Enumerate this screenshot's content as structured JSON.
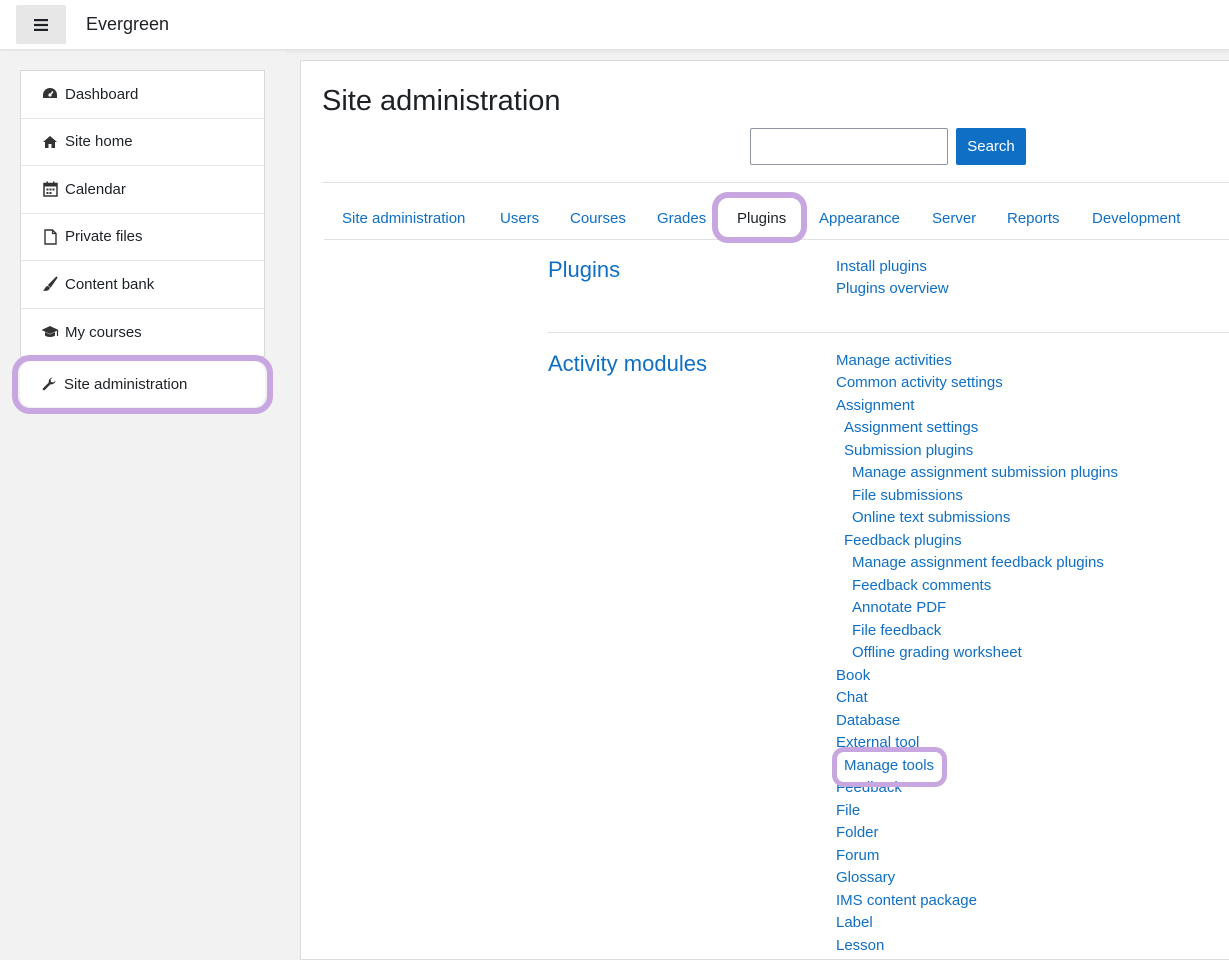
{
  "navbar": {
    "brand": "Evergreen",
    "menu_icon": "hamburger-menu-icon"
  },
  "drawer": {
    "items": [
      {
        "label": "Dashboard",
        "icon": "dashboard-icon"
      },
      {
        "label": "Site home",
        "icon": "home-icon"
      },
      {
        "label": "Calendar",
        "icon": "calendar-icon"
      },
      {
        "label": "Private files",
        "icon": "file-icon"
      },
      {
        "label": "Content bank",
        "icon": "paint-brush-icon"
      },
      {
        "label": "My courses",
        "icon": "graduation-cap-icon"
      }
    ],
    "site_admin": {
      "label": "Site administration",
      "icon": "wrench-icon"
    }
  },
  "main": {
    "title": "Site administration",
    "search": {
      "value": "",
      "placeholder": "",
      "button_label": "Search"
    },
    "tabs": [
      {
        "label": "Site administration"
      },
      {
        "label": "Users"
      },
      {
        "label": "Courses"
      },
      {
        "label": "Grades"
      },
      {
        "label": "Plugins",
        "active": true
      },
      {
        "label": "Appearance"
      },
      {
        "label": "Server"
      },
      {
        "label": "Reports"
      },
      {
        "label": "Development"
      }
    ],
    "sections": [
      {
        "heading": "Plugins",
        "links": [
          "Install plugins",
          "Plugins overview"
        ]
      },
      {
        "heading": "Activity modules",
        "links": [
          "Manage activities",
          "Common activity settings",
          "Assignment",
          "Assignment settings",
          "Submission plugins",
          "Manage assignment submission plugins",
          "File submissions",
          "Online text submissions",
          "Feedback plugins",
          "Manage assignment feedback plugins",
          "Feedback comments",
          "Annotate PDF",
          "File feedback",
          "Offline grading worksheet",
          "Book",
          "Chat",
          "Database",
          "External tool",
          "Manage tools",
          "Feedback",
          "File",
          "Folder",
          "Forum",
          "Glossary",
          "IMS content package",
          "Label",
          "Lesson"
        ]
      }
    ]
  },
  "colors": {
    "link": "#0f6fc5",
    "highlight": "#c8a6e0",
    "button": "#0f6fc5",
    "background": "#f2f2f2"
  }
}
